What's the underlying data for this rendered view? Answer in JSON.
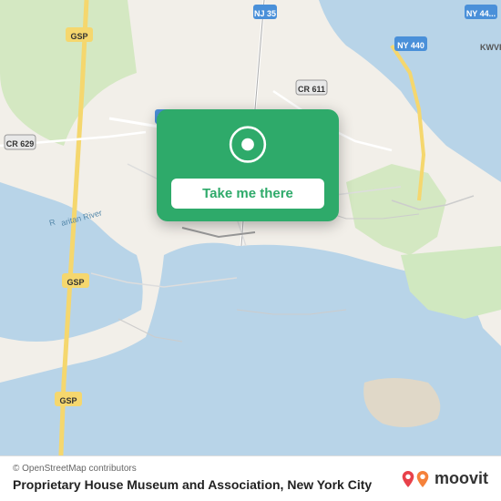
{
  "map": {
    "attribution": "© OpenStreetMap contributors",
    "background_color": "#e8e0d8"
  },
  "popup": {
    "button_label": "Take me there",
    "button_color": "#2eaa6a",
    "text_color": "#ffffff"
  },
  "bottom_bar": {
    "place_name": "Proprietary House Museum and Association, New York City"
  },
  "moovit": {
    "logo_text": "moovit"
  },
  "icons": {
    "location_pin": "location-pin-icon",
    "moovit_pin_red": "moovit-pin-red-icon",
    "moovit_pin_orange": "moovit-pin-orange-icon"
  }
}
